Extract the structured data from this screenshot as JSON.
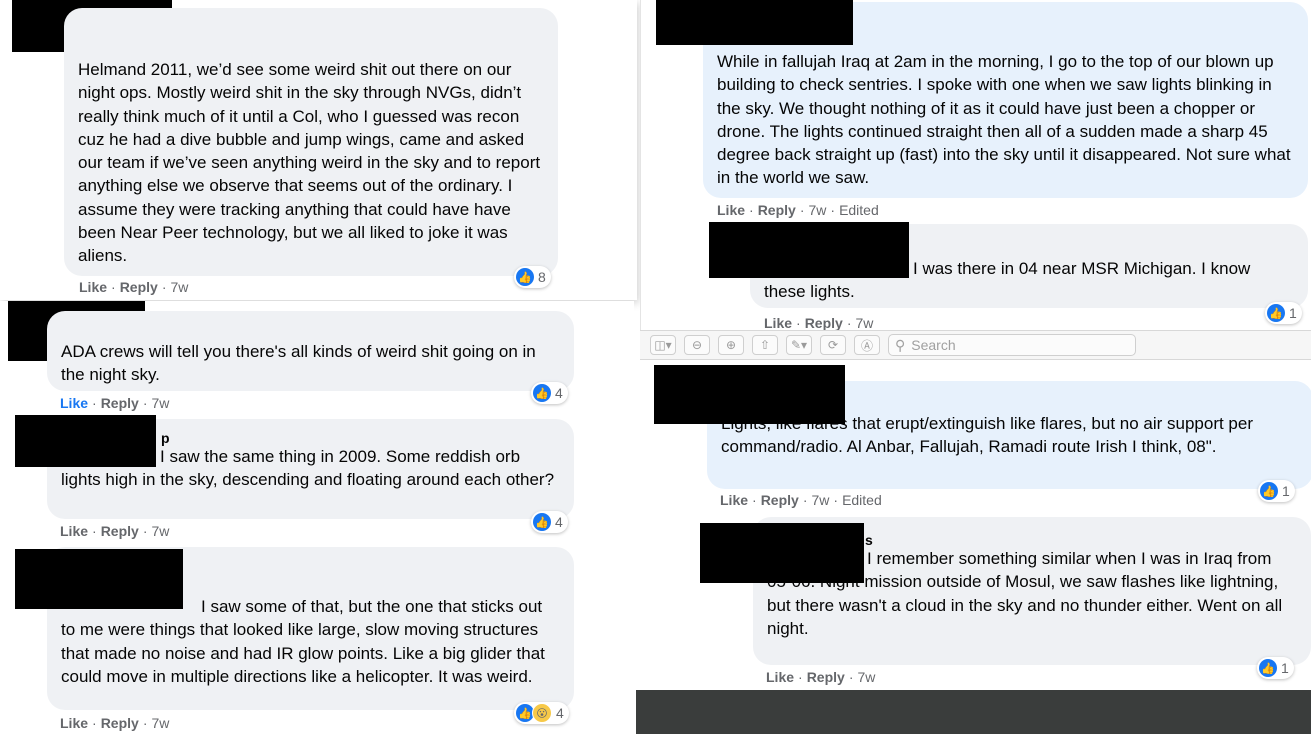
{
  "toolbar": {
    "search_placeholder": "Search"
  },
  "meta": {
    "like": "Like",
    "reply": "Reply",
    "sep": "·",
    "edited": "Edited"
  },
  "comments": [
    {
      "text": "Helmand 2011, we’d see some weird shit out there on our night ops. Mostly weird shit in the sky through NVGs, didn’t really think much of it until a Col, who I guessed was recon cuz he had a dive bubble and jump wings, came and asked our team if we’ve seen anything weird in the sky and to report anything else we observe that seems out of the ordinary. I assume they were tracking anything that could have have been Near Peer technology, but we all liked to joke it was aliens.",
      "time": "7w",
      "reactions": "8"
    },
    {
      "text": "ADA crews will tell you there's all kinds of weird shit going on in the night sky.",
      "time": "7w",
      "reactions": "4"
    },
    {
      "name_fragment": "p",
      "text": "I saw the same thing in 2009. Some reddish orb lights high in the sky, descending and floating around each other?",
      "time": "7w",
      "reactions": "4"
    },
    {
      "text": "I saw some of that, but the one that sticks out to me were things that looked like large, slow moving structures that made no noise and had IR glow points. Like a big glider that could move in multiple directions like a helicopter. It was weird.",
      "time": "7w",
      "reactions": "4"
    },
    {
      "text": "While in fallujah Iraq at 2am in the morning, I go to the top of our blown up building to check sentries. I spoke with one when we saw lights blinking in the sky. We thought nothing of it as it could have just been a chopper or drone. The lights continued straight then all of a sudden made a sharp 45 degree back straight up (fast) into the sky until it disappeared. Not sure what in the world we saw.",
      "time": "7w"
    },
    {
      "text": "I was there in 04 near MSR Michigan. I know these lights.",
      "time": "7w",
      "reactions": "1"
    },
    {
      "text": "Lights, like flares that erupt/extinguish like flares, but no air support per command/radio. Al Anbar, Fallujah, Ramadi route Irish I think, 08\".",
      "time": "7w",
      "reactions": "1"
    },
    {
      "name_fragment": "s",
      "text": "I remember something similar when I was in Iraq from 05-06. Night mission outside of Mosul, we saw flashes like lightning, but there wasn't a cloud in the sky and no thunder either. Went on all night.",
      "time": "7w",
      "reactions": "1"
    }
  ]
}
